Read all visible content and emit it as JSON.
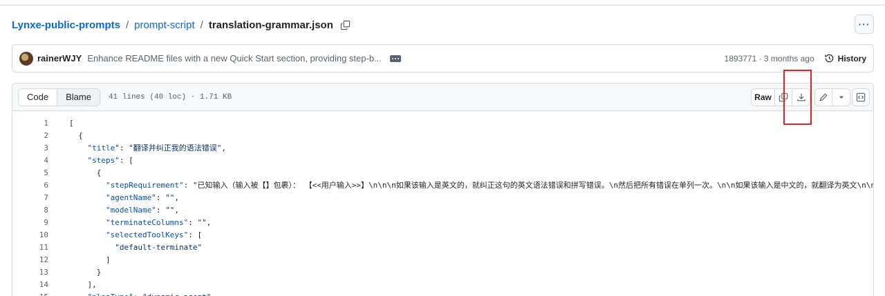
{
  "breadcrumb": {
    "repo": "Lynxe-public-prompts",
    "folder": "prompt-script",
    "file": "translation-grammar.json"
  },
  "commit": {
    "author": "rainerWJY",
    "message": "Enhance README files with a new Quick Start section, providing step-b...",
    "meta": "1893771 · 3 months ago",
    "history_label": "History"
  },
  "file_header": {
    "tab_code": "Code",
    "tab_blame": "Blame",
    "info": "41 lines (40 loc) · 1.71 KB",
    "raw_label": "Raw"
  },
  "code_lines": [
    {
      "n": "1",
      "t": "["
    },
    {
      "n": "2",
      "t": "  {"
    },
    {
      "n": "3",
      "t": "    \"title\": \"翻译并纠正我的语法错误\","
    },
    {
      "n": "4",
      "t": "    \"steps\": ["
    },
    {
      "n": "5",
      "t": "      {"
    },
    {
      "n": "6",
      "t": "        \"stepRequirement\": \"已知输入（输入被【】包裹）： 【<<用户输入>>】\\n\\n\\n如果该输入是英文的，就纠正这句的英文语法错误和拼写错误。\\n然后把所有错误在单列一次。\\n\\n如果该输入是中文的，就翻译为英文\\n\\n格式例子："
    },
    {
      "n": "7",
      "t": "        \"agentName\": \"\","
    },
    {
      "n": "8",
      "t": "        \"modelName\": \"\","
    },
    {
      "n": "9",
      "t": "        \"terminateColumns\": \"\","
    },
    {
      "n": "10",
      "t": "        \"selectedToolKeys\": ["
    },
    {
      "n": "11",
      "t": "          \"default-terminate\""
    },
    {
      "n": "12",
      "t": "        ]"
    },
    {
      "n": "13",
      "t": "      }"
    },
    {
      "n": "14",
      "t": "    ],"
    },
    {
      "n": "15",
      "t": "    \"planType\": \"dynamic_agent\","
    }
  ],
  "colors": {
    "link": "#0969da",
    "annotation": "#e5231b",
    "json_key": "#0550ae",
    "json_string": "#0a3069"
  }
}
